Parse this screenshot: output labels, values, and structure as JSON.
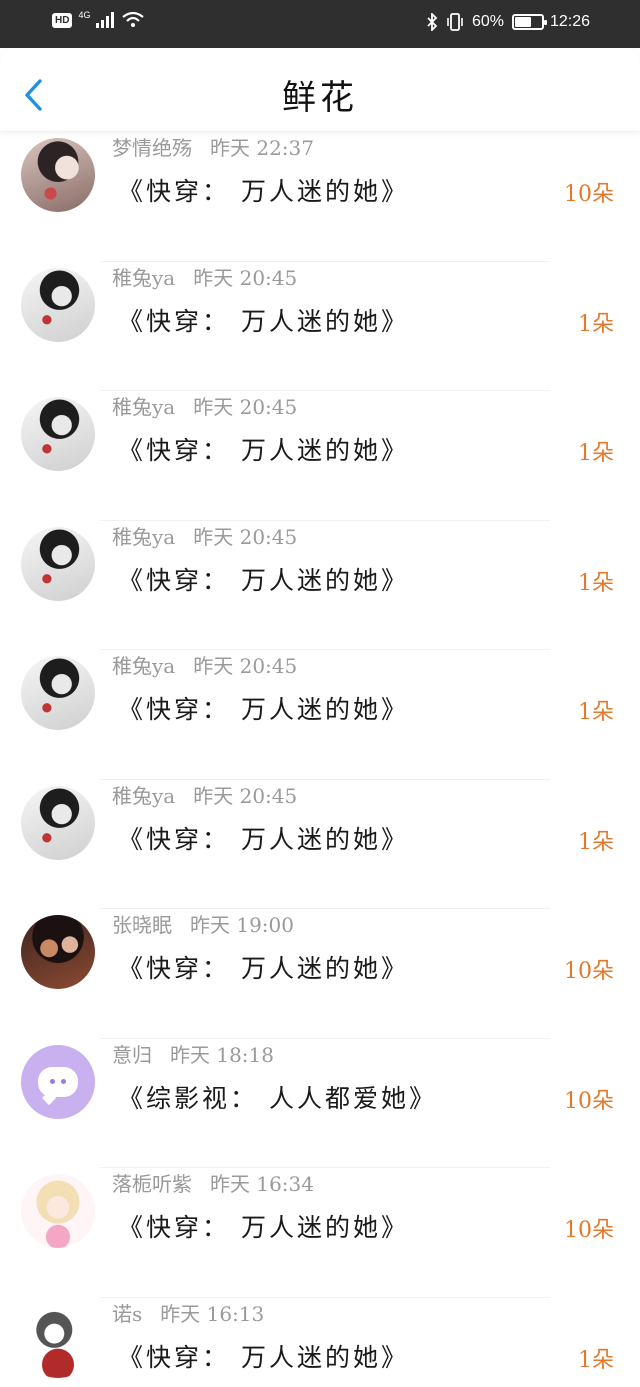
{
  "status_bar": {
    "hd": "HD",
    "network": "4G",
    "battery_text": "60%",
    "battery_level": 0.6,
    "time": "12:26",
    "icons": [
      "signal-icon",
      "wifi-icon",
      "bluetooth-icon",
      "vibrate-icon",
      "battery-icon"
    ]
  },
  "header": {
    "back_icon": "chevron-left-icon",
    "title": "鲜花"
  },
  "items": [
    {
      "user": "梦情绝殇",
      "time": "昨天 22:37",
      "book": "《快穿： 万人迷的她》",
      "amount": "10朵",
      "avatar": "portrait"
    },
    {
      "user": "稚兔ya",
      "time": "昨天 20:45",
      "book": "《快穿： 万人迷的她》",
      "amount": "1朵",
      "avatar": "bw"
    },
    {
      "user": "稚兔ya",
      "time": "昨天 20:45",
      "book": "《快穿： 万人迷的她》",
      "amount": "1朵",
      "avatar": "bw"
    },
    {
      "user": "稚兔ya",
      "time": "昨天 20:45",
      "book": "《快穿： 万人迷的她》",
      "amount": "1朵",
      "avatar": "bw"
    },
    {
      "user": "稚兔ya",
      "time": "昨天 20:45",
      "book": "《快穿： 万人迷的她》",
      "amount": "1朵",
      "avatar": "bw"
    },
    {
      "user": "稚兔ya",
      "time": "昨天 20:45",
      "book": "《快穿： 万人迷的她》",
      "amount": "1朵",
      "avatar": "bw"
    },
    {
      "user": "张晓眠",
      "time": "昨天 19:00",
      "book": "《快穿： 万人迷的她》",
      "amount": "10朵",
      "avatar": "couple"
    },
    {
      "user": "意归",
      "time": "昨天 18:18",
      "book": "《综影视： 人人都爱她》",
      "amount": "10朵",
      "avatar": "chat"
    },
    {
      "user": "落栀听紫",
      "time": "昨天 16:34",
      "book": "《快穿： 万人迷的她》",
      "amount": "10朵",
      "avatar": "anime"
    },
    {
      "user": "诺s",
      "time": "昨天 16:13",
      "book": "《快穿： 万人迷的她》",
      "amount": "1朵",
      "avatar": "sketch"
    }
  ],
  "colors": {
    "status_bar_bg": "#2f2f2f",
    "back_arrow": "#1e90e6",
    "amount": "#e4782b",
    "meta": "#9a9a9a"
  }
}
